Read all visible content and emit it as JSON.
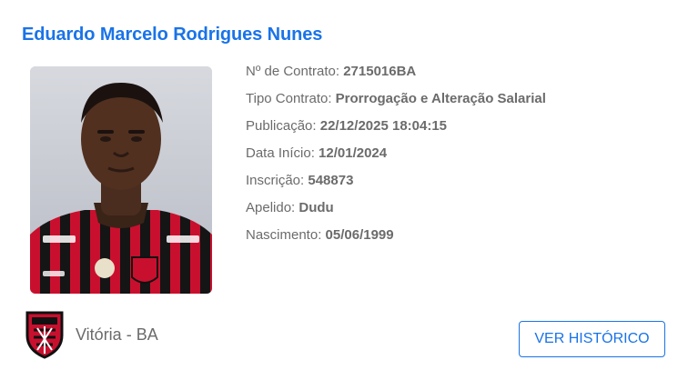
{
  "player": {
    "name": "Eduardo Marcelo Rodrigues Nunes",
    "photo_icon": "player-portrait-photo"
  },
  "contract": {
    "rows": [
      {
        "label": "Nº de Contrato:",
        "value": "2715016BA"
      },
      {
        "label": "Tipo Contrato:",
        "value": "Prorrogação e Alteração Salarial"
      },
      {
        "label": "Publicação:",
        "value": "22/12/2025 18:04:15"
      },
      {
        "label": "Data Início:",
        "value": "12/01/2024"
      },
      {
        "label": "Inscrição:",
        "value": "548873"
      },
      {
        "label": "Apelido:",
        "value": "Dudu"
      },
      {
        "label": "Nascimento:",
        "value": "05/06/1999"
      }
    ]
  },
  "club": {
    "name": "Vitória - BA",
    "crest_icon": "club-crest-icon",
    "colors": {
      "red": "#c8102e",
      "black": "#111111"
    }
  },
  "actions": {
    "history_label": "VER HISTÓRICO"
  },
  "theme": {
    "accent": "#1a73e8",
    "text": "#6b6b6b"
  }
}
